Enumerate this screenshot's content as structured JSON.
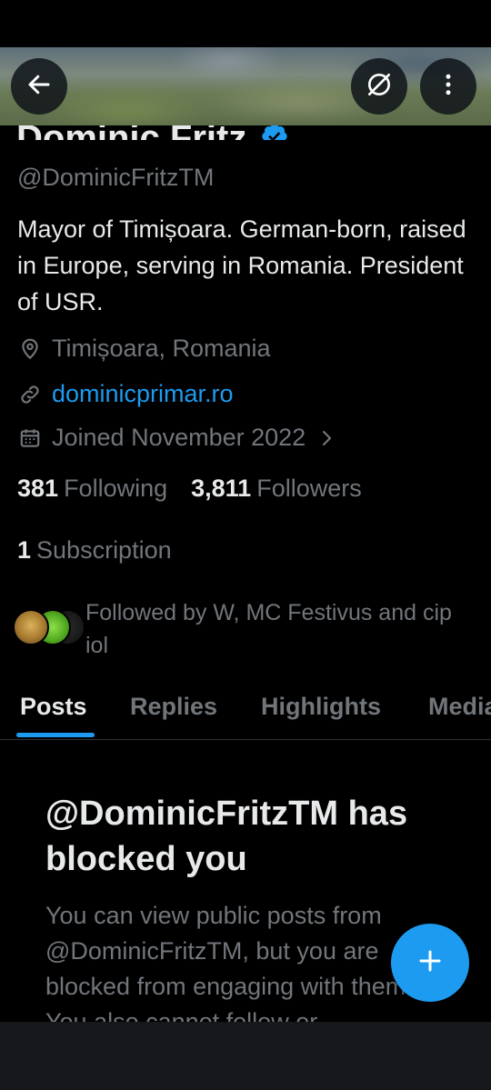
{
  "profile": {
    "name": "Dominic Fritz",
    "handle": "@DominicFritzTM",
    "bio": "Mayor of Timișoara. German-born, raised in Europe, serving in Romania. President of USR.",
    "location": "Timișoara, Romania",
    "website": "dominicprimar.ro",
    "joined": "Joined November 2022",
    "following_count": "381",
    "following_label": "Following",
    "followers_count": "3,811",
    "followers_label": "Followers",
    "subscription_count": "1",
    "subscription_label": "Subscription",
    "followed_by": "Followed by W, MC Festivus and cip iol"
  },
  "header": {
    "back_icon": "arrow-left-icon",
    "mute_icon": "notifications-off-icon",
    "more_icon": "more-vertical-icon"
  },
  "tabs": [
    {
      "label": "Posts",
      "active": true
    },
    {
      "label": "Replies",
      "active": false
    },
    {
      "label": "Highlights",
      "active": false
    },
    {
      "label": "Media",
      "active": false
    }
  ],
  "blocked": {
    "title": "@DominicFritzTM has blocked you",
    "body": "You can view public posts from @DominicFritzTM, but you are blocked from engaging with them. You also cannot follow or"
  },
  "fab": {
    "icon": "plus-icon"
  },
  "colors": {
    "accent": "#1d9bf0",
    "background": "#000000",
    "text_primary": "#e7e9ea",
    "text_secondary": "#71767b"
  }
}
